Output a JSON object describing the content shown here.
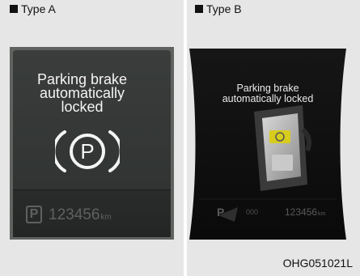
{
  "type_a": {
    "label": "Type A",
    "message": [
      "Parking brake",
      "automatically",
      "locked"
    ],
    "parking_icon_letter": "P",
    "indicator_letter": "P",
    "odometer": "123456",
    "odometer_unit": "km"
  },
  "type_b": {
    "label": "Type B",
    "message": [
      "Parking brake",
      "automatically locked"
    ],
    "indicator_letter": "P",
    "trip_odometer": "000",
    "odometer": "123456",
    "odometer_unit": "km"
  },
  "figure_code": "OHG051021L",
  "colors": {
    "panel_bg": "#e6e6e6",
    "display_bg": "#2e312f",
    "switch_indicator": "#d7cc1d"
  }
}
